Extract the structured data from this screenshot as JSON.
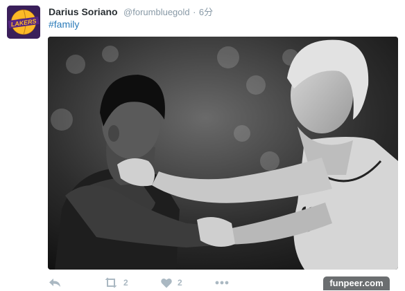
{
  "tweet": {
    "author_name": "Darius Soriano",
    "handle": "@forumbluegold",
    "separator": "·",
    "time": "6分",
    "text_hashtag": "#family",
    "avatar_text": "LAKERS"
  },
  "actions": {
    "retweet_count": "2",
    "like_count": "2"
  },
  "watermark": "funpeer.com",
  "colors": {
    "link": "#2b7bb9",
    "muted": "#8899a6",
    "action_icon": "#aab8c2",
    "lakers_purple": "#552583",
    "lakers_gold": "#fdb927"
  },
  "icons": [
    "reply-icon",
    "retweet-icon",
    "heart-icon",
    "more-icon"
  ]
}
